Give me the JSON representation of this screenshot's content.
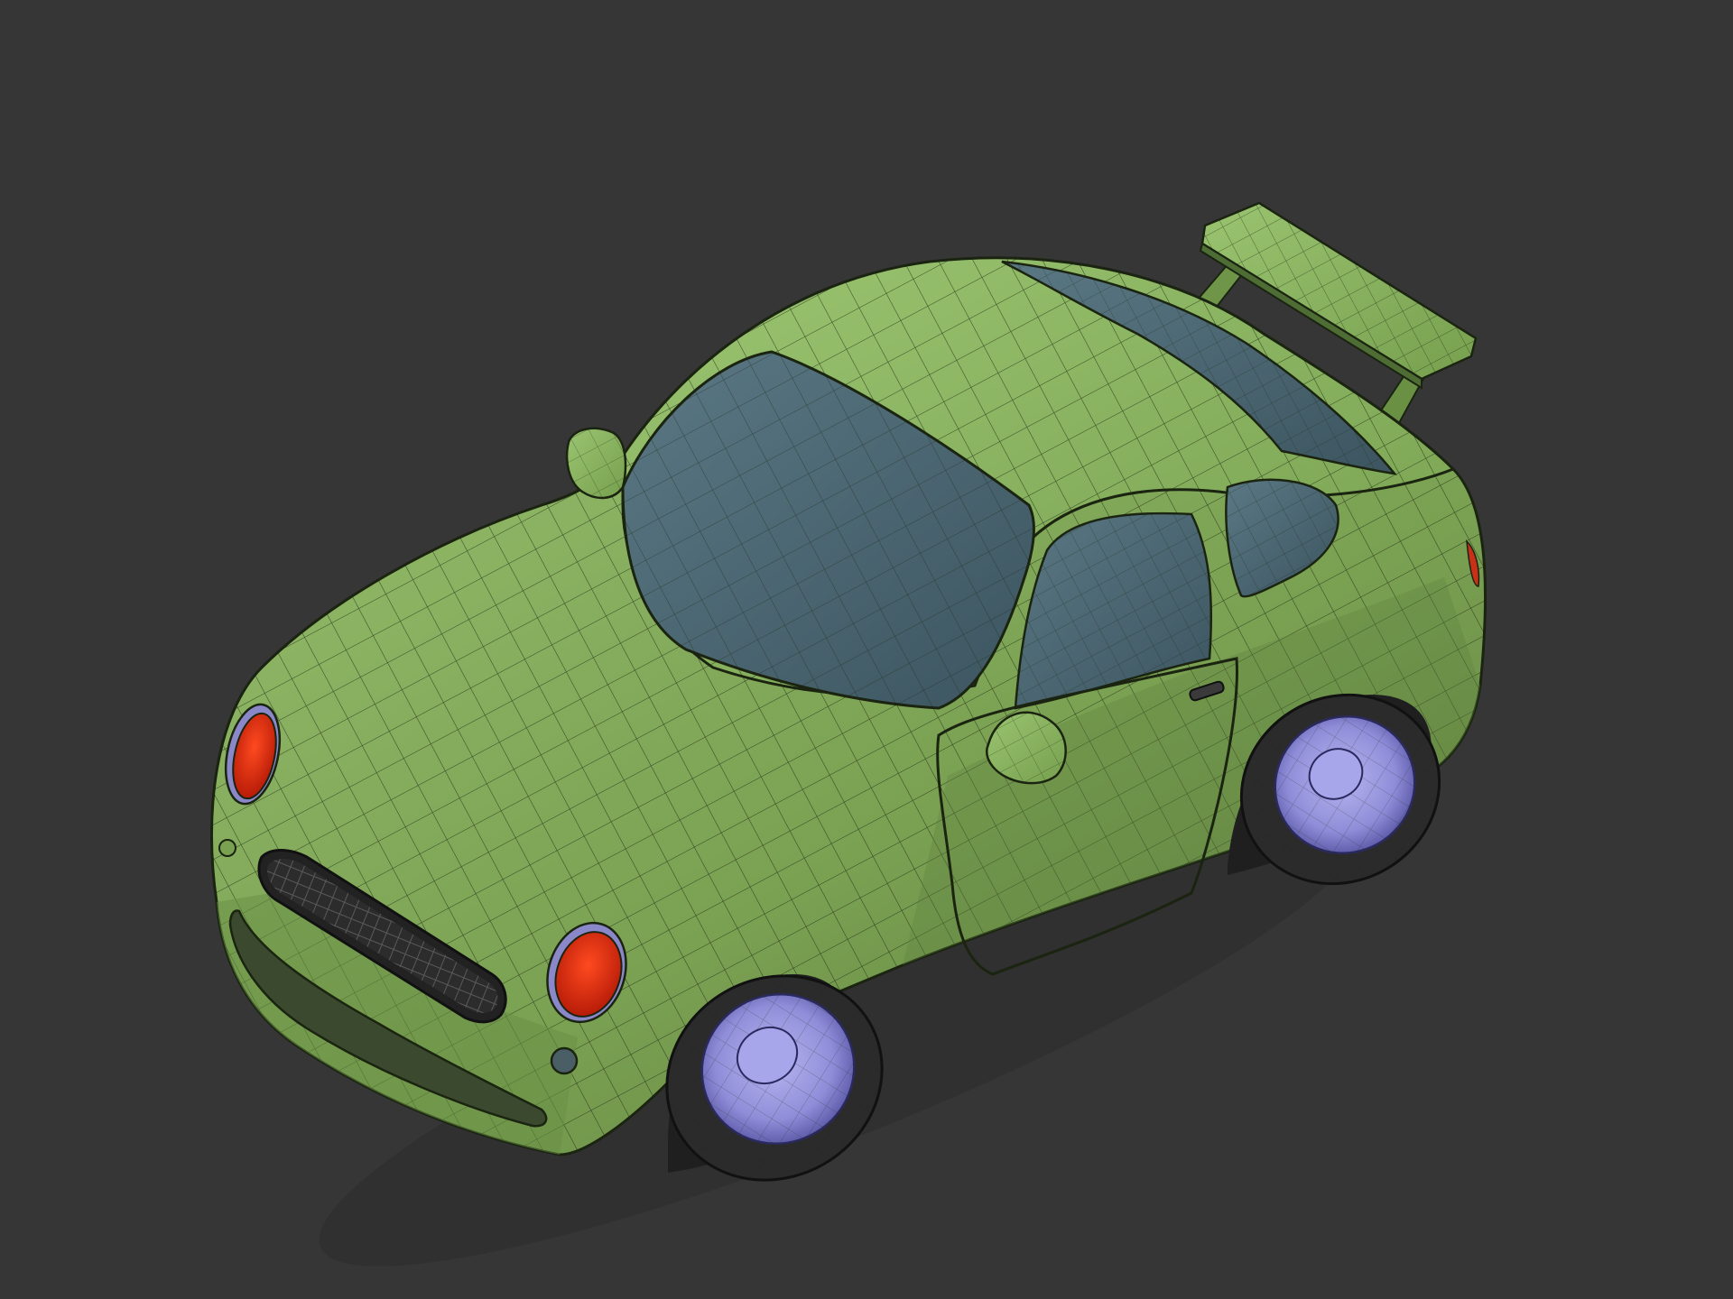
{
  "scene": {
    "subject": "stylized-car-wireframe-model",
    "view": "isometric-front-left",
    "shading": "solid-with-wireframe-overlay"
  },
  "colors": {
    "background": "#363636",
    "body": "#7aa052",
    "body_light": "#8fb866",
    "body_shadow": "#5a7a3c",
    "glass": "#4a6470",
    "glass_dark": "#3b525c",
    "headlight": "#e02a10",
    "headlight_ring": "#8a88c8",
    "rim": "#9a98e0",
    "rim_dark": "#6e6cb8",
    "tire": "#2b2b2b",
    "grille": "#2a2a2a",
    "wire": "#1a2410"
  },
  "icons": [
    "car-model"
  ]
}
